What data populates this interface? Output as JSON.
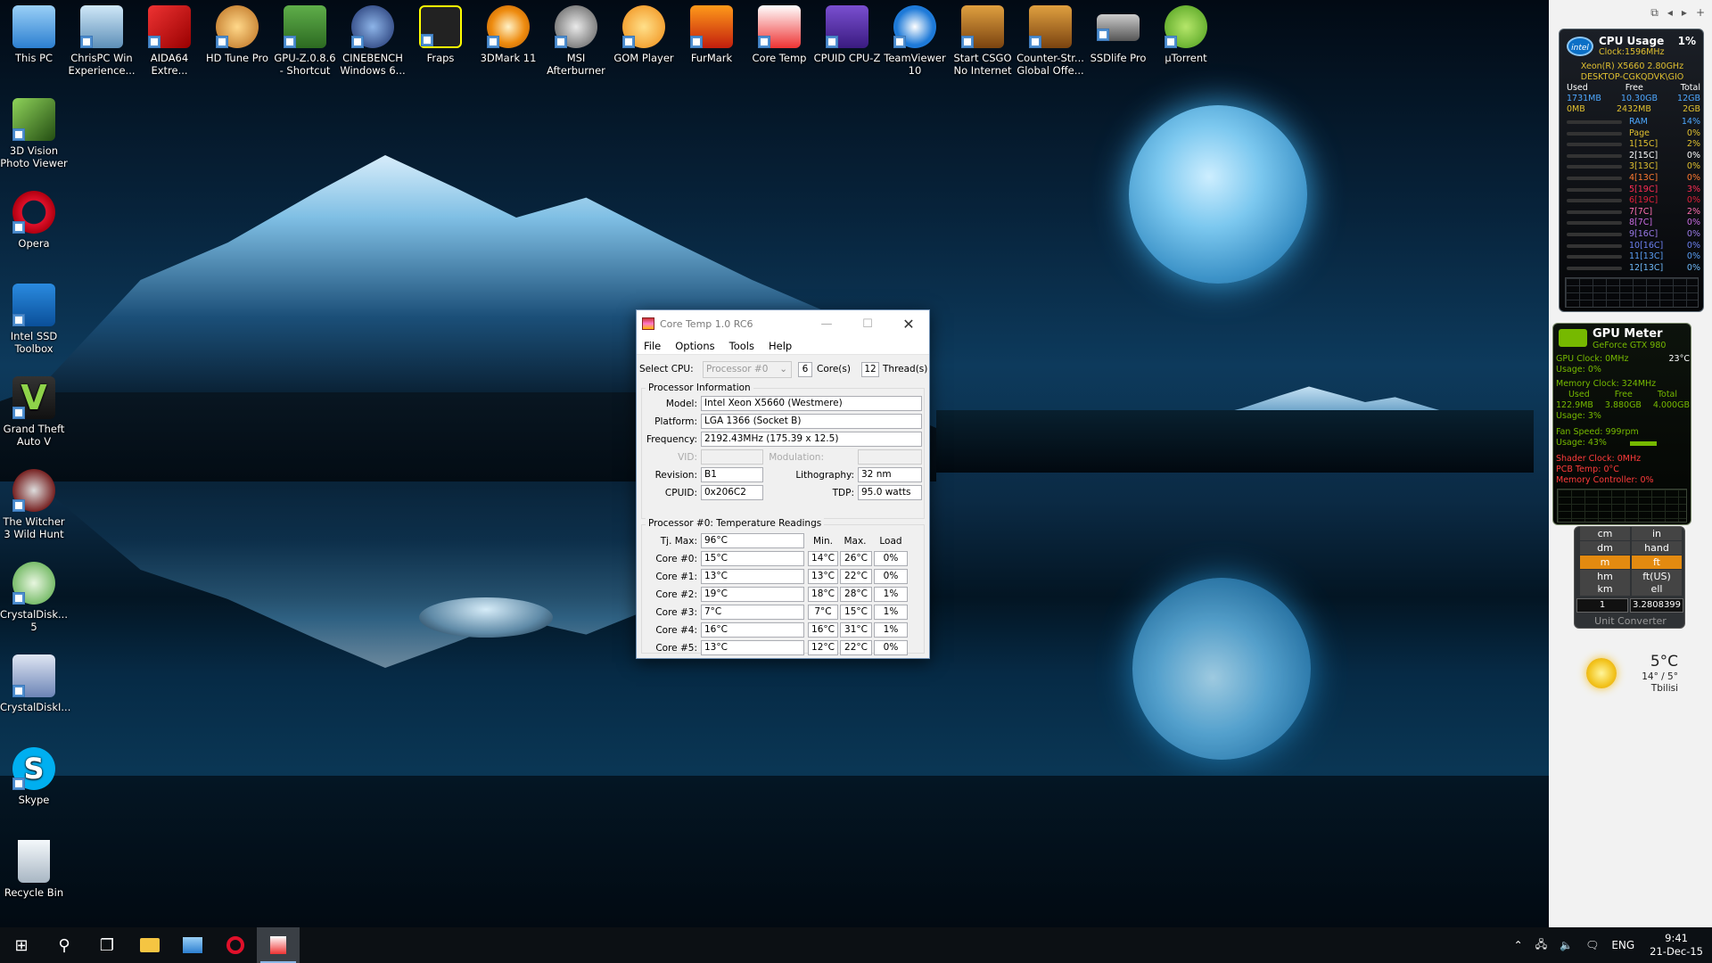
{
  "desktop": {
    "icons": [
      {
        "label": "This PC",
        "icon": "computer-icon"
      },
      {
        "label": "ChrisPC Win Experience...",
        "icon": "computer-icon"
      },
      {
        "label": "AIDA64 Extre...",
        "icon": "aida64-icon"
      },
      {
        "label": "HD Tune Pro",
        "icon": "hdtune-icon"
      },
      {
        "label": "GPU-Z.0.8.6 - Shortcut",
        "icon": "gpuz-icon"
      },
      {
        "label": "CINEBENCH Windows 6...",
        "icon": "cinebench-icon"
      },
      {
        "label": "Fraps",
        "icon": "fraps-icon"
      },
      {
        "label": "3DMark 11",
        "icon": "3dmark-icon"
      },
      {
        "label": "MSI Afterburner",
        "icon": "afterburner-icon"
      },
      {
        "label": "GOM Player",
        "icon": "gom-icon"
      },
      {
        "label": "FurMark",
        "icon": "furmark-icon"
      },
      {
        "label": "Core Temp",
        "icon": "coretemp-icon"
      },
      {
        "label": "CPUID CPU-Z",
        "icon": "cpuz-icon"
      },
      {
        "label": "TeamViewer 10",
        "icon": "teamviewer-icon"
      },
      {
        "label": "Start CSGO No Internet",
        "icon": "csgo-icon"
      },
      {
        "label": "Counter-Str... Global Offe...",
        "icon": "csgo-icon"
      },
      {
        "label": "SSDlife Pro",
        "icon": "ssd-icon"
      },
      {
        "label": "µTorrent",
        "icon": "utorrent-icon"
      },
      {
        "label": "3D Vision Photo Viewer",
        "icon": "3dvision-icon"
      },
      {
        "label": "Opera",
        "icon": "opera-icon"
      },
      {
        "label": "Intel SSD Toolbox",
        "icon": "intel-icon"
      },
      {
        "label": "Grand Theft Auto V",
        "icon": "gtav-icon"
      },
      {
        "label": "The Witcher 3 Wild Hunt",
        "icon": "witcher-icon"
      },
      {
        "label": "CrystalDisk... 5",
        "icon": "crystaldisk-icon"
      },
      {
        "label": "CrystalDiskI...",
        "icon": "crystaldisk-icon"
      },
      {
        "label": "Skype",
        "icon": "skype-icon"
      },
      {
        "label": "Recycle Bin",
        "icon": "recycle-bin-icon"
      }
    ]
  },
  "coretemp": {
    "title": "Core Temp 1.0 RC6",
    "menu": [
      "File",
      "Options",
      "Tools",
      "Help"
    ],
    "select_cpu_label": "Select CPU:",
    "processor_select": "Processor #0",
    "cores_value": "6",
    "cores_label": "Core(s)",
    "threads_value": "12",
    "threads_label": "Thread(s)",
    "proc_info_title": "Processor Information",
    "model_label": "Model:",
    "model": "Intel Xeon X5660 (Westmere)",
    "platform_label": "Platform:",
    "platform": "LGA 1366 (Socket B)",
    "frequency_label": "Frequency:",
    "frequency": "2192.43MHz (175.39 x 12.5)",
    "vid_label": "VID:",
    "vid": "",
    "modulation_label": "Modulation:",
    "modulation": "",
    "revision_label": "Revision:",
    "revision": "B1",
    "lithography_label": "Lithography:",
    "lithography": "32 nm",
    "cpuid_label": "CPUID:",
    "cpuid": "0x206C2",
    "tdp_label": "TDP:",
    "tdp": "95.0 watts",
    "temp_title": "Processor #0: Temperature Readings",
    "tjmax_label": "Tj. Max:",
    "tjmax": "96°C",
    "col_min": "Min.",
    "col_max": "Max.",
    "col_load": "Load",
    "cores": [
      {
        "label": "Core #0:",
        "temp": "15°C",
        "min": "14°C",
        "max": "26°C",
        "load": "0%"
      },
      {
        "label": "Core #1:",
        "temp": "13°C",
        "min": "13°C",
        "max": "22°C",
        "load": "0%"
      },
      {
        "label": "Core #2:",
        "temp": "19°C",
        "min": "18°C",
        "max": "28°C",
        "load": "1%"
      },
      {
        "label": "Core #3:",
        "temp": "7°C",
        "min": "7°C",
        "max": "15°C",
        "load": "1%"
      },
      {
        "label": "Core #4:",
        "temp": "16°C",
        "min": "16°C",
        "max": "31°C",
        "load": "1%"
      },
      {
        "label": "Core #5:",
        "temp": "13°C",
        "min": "12°C",
        "max": "22°C",
        "load": "0%"
      }
    ]
  },
  "cpu_gadget": {
    "badge": "intel",
    "title": "CPU Usage",
    "usage": "1%",
    "clock": "Clock:1596MHz",
    "cpu_name": "Xeon(R) X5660 2.80GHz",
    "host": "DESKTOP-CGKQDVK\\GIO",
    "hdr_used": "Used",
    "hdr_free": "Free",
    "hdr_total": "Total",
    "ram_used": "1731MB",
    "ram_free": "10.30GB",
    "ram_total": "12GB",
    "page_used": "0MB",
    "page_free": "2432MB",
    "page_total": "2GB",
    "rows": [
      {
        "name": "RAM",
        "value": "14%",
        "color": "#4ea8ff"
      },
      {
        "name": "Page",
        "value": "0%",
        "color": "#e0c030"
      },
      {
        "name": "1[15C]",
        "value": "2%",
        "color": "#e0c030"
      },
      {
        "name": "2[15C]",
        "value": "0%",
        "color": "#ffffff"
      },
      {
        "name": "3[13C]",
        "value": "0%",
        "color": "#e0c030"
      },
      {
        "name": "4[13C]",
        "value": "0%",
        "color": "#ff7a30"
      },
      {
        "name": "5[19C]",
        "value": "3%",
        "color": "#ff2d55"
      },
      {
        "name": "6[19C]",
        "value": "0%",
        "color": "#e0203a"
      },
      {
        "name": "7[7C]",
        "value": "2%",
        "color": "#ff6fb0"
      },
      {
        "name": "8[7C]",
        "value": "0%",
        "color": "#c86be0"
      },
      {
        "name": "9[16C]",
        "value": "0%",
        "color": "#9a7ae8"
      },
      {
        "name": "10[16C]",
        "value": "0%",
        "color": "#6b80f0"
      },
      {
        "name": "11[13C]",
        "value": "0%",
        "color": "#5a9ef5"
      },
      {
        "name": "12[13C]",
        "value": "0%",
        "color": "#6fb8f8"
      }
    ]
  },
  "gpu_gadget": {
    "title": "GPU Meter",
    "card": "GeForce GTX 980",
    "gpu_clock": "GPU Clock: 0MHz",
    "gpu_temp": "23°C",
    "usage": "Usage: 0%",
    "mem_clock": "Memory Clock: 324MHz",
    "mem_used_h": "Used",
    "mem_free_h": "Free",
    "mem_total_h": "Total",
    "mem_used": "122.9MB",
    "mem_free": "3.880GB",
    "mem_total": "4.000GB",
    "mem_usage": "Usage: 3%",
    "fan_speed": "Fan Speed: 999rpm",
    "fan_usage": "Usage: 43%",
    "shader_clock": "Shader Clock: 0MHz",
    "pcb_temp": "PCB Temp: 0°C",
    "mem_ctrl": "Memory Controller: 0%"
  },
  "unit_converter": {
    "row0": [
      "cm",
      "in"
    ],
    "row1": [
      "dm",
      "hand"
    ],
    "row2": [
      "m",
      "ft"
    ],
    "row3": [
      "hm",
      "ft(US)"
    ],
    "row4": [
      "km",
      "ell"
    ],
    "input_left": "1",
    "input_right": "3.2808399",
    "footer": "Unit Converter"
  },
  "weather": {
    "temp": "5°C",
    "range": "14° / 5°",
    "city": "Tbilisi"
  },
  "taskbar": {
    "lang": "ENG",
    "time": "9:41",
    "date": "21-Dec-15"
  }
}
